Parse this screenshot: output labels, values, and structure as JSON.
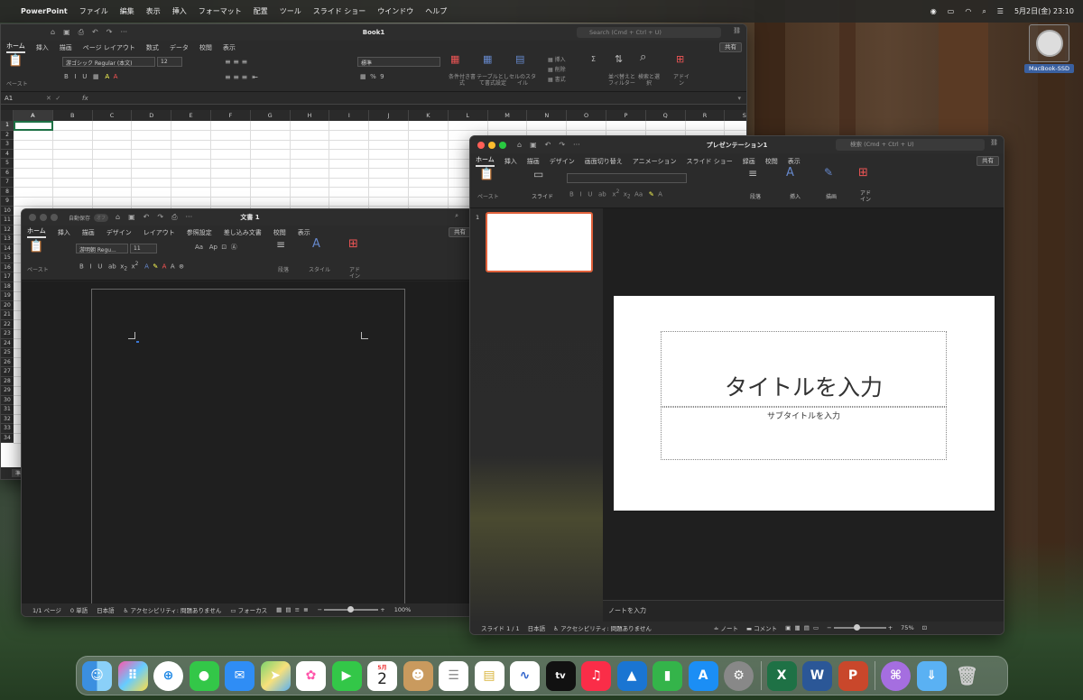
{
  "menubar": {
    "app": "PowerPoint",
    "items": [
      "ファイル",
      "編集",
      "表示",
      "挿入",
      "フォーマット",
      "配置",
      "ツール",
      "スライド ショー",
      "ウインドウ",
      "ヘルプ"
    ],
    "datetime": "5月2日(金)  23:10"
  },
  "desktop_drive": {
    "label": "MacBook-SSD"
  },
  "excel": {
    "title": "Book1",
    "search": "Search (Cmd + Ctrl + U)",
    "share": "共有",
    "tabs": [
      "ホーム",
      "挿入",
      "描画",
      "ページ レイアウト",
      "数式",
      "データ",
      "校閲",
      "表示"
    ],
    "font": "游ゴシック Regular (本文)",
    "size": "12",
    "number_format": "標準",
    "cell_ref": "A1",
    "fx": "fx",
    "paste": "ペースト",
    "cond_format": "条件付き書式",
    "table_format": "テーブルとして書式設定",
    "cell_style": "セルのスタイル",
    "insert": "挿入",
    "delete": "削除",
    "format": "書式",
    "sort_filter": "並べ替えとフィルター",
    "find_select": "検索と選択",
    "addins": "アドイン",
    "columns": [
      "A",
      "B",
      "C",
      "D",
      "E",
      "F",
      "G",
      "H",
      "I",
      "J",
      "K",
      "L",
      "M",
      "N",
      "O",
      "P",
      "Q",
      "R",
      "S"
    ],
    "rows": [
      "1",
      "2",
      "3",
      "4",
      "5",
      "6",
      "7",
      "8",
      "9",
      "10",
      "11",
      "12",
      "13",
      "14",
      "15",
      "16",
      "17",
      "18",
      "19",
      "20",
      "21",
      "22",
      "23",
      "24",
      "25",
      "26",
      "27",
      "28",
      "29",
      "30",
      "31",
      "32",
      "33",
      "34"
    ],
    "sheet_tab": "準備"
  },
  "word": {
    "title": "文書 1",
    "autosave": "自動保存",
    "autosave_state": "オフ",
    "share": "共有",
    "tabs": [
      "ホーム",
      "挿入",
      "描画",
      "デザイン",
      "レイアウト",
      "参照設定",
      "差し込み文書",
      "校閲",
      "表示"
    ],
    "font": "游明朝 Regu...",
    "size": "11",
    "paste": "ペースト",
    "paragraph": "段落",
    "styles": "スタイル",
    "addins": "アドイン",
    "status": {
      "page": "1/1 ページ",
      "words": "0 単語",
      "lang": "日本語",
      "a11y": "アクセシビリティ: 問題ありません",
      "focus": "フォーカス",
      "zoom": "100%"
    }
  },
  "ppt": {
    "title": "プレゼンテーション1",
    "search": "検索 (Cmd + Ctrl + U)",
    "share": "共有",
    "tabs": [
      "ホーム",
      "挿入",
      "描画",
      "デザイン",
      "画面切り替え",
      "アニメーション",
      "スライド ショー",
      "録画",
      "校閲",
      "表示"
    ],
    "paste": "ペースト",
    "slide": "スライド",
    "paragraph": "段落",
    "insert": "挿入",
    "draw": "描画",
    "addins": "アドイン",
    "slide_num": "1",
    "title_ph": "タイトルを入力",
    "subtitle_ph": "サブタイトルを入力",
    "notes": "ノートを入力",
    "status": {
      "slide": "スライド 1 / 1",
      "lang": "日本語",
      "a11y": "アクセシビリティ: 問題ありません",
      "notes": "ノート",
      "comments": "コメント",
      "zoom": "75%"
    }
  },
  "dock": {
    "calendar_month": "5月",
    "calendar_day": "2",
    "tv": "tv"
  }
}
